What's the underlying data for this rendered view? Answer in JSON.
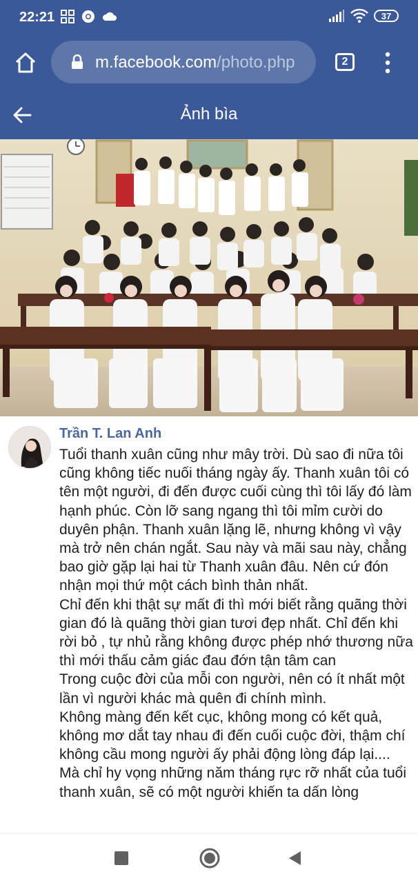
{
  "status_bar": {
    "time": "22:21",
    "battery": "37",
    "icons": [
      "grid-app-icon",
      "chrome-icon",
      "cloud-icon",
      "signal-icon",
      "wifi-icon",
      "battery-icon"
    ]
  },
  "browser": {
    "url_domain": "m.facebook.com",
    "url_path": "/photo.php",
    "tab_count": "2"
  },
  "header": {
    "title": "Ảnh bìa"
  },
  "photo": {
    "description_icons": [
      "wall-clock",
      "notice-board",
      "banner"
    ]
  },
  "post": {
    "author": "Trần T. Lan Anh",
    "paragraphs": [
      "Tuổi thanh xuân cũng như mây trời. Dù sao đi nữa tôi cũng không tiếc nuối tháng ngày ấy. Thanh xuân tôi có tên một người, đi đến được cuối cùng thì tôi lấy đó làm hạnh phúc. Còn lỡ sang ngang thì tôi mỉm cười do duyên phận. Thanh xuân lặng lẽ, nhưng không vì vậy mà trở nên chán ngắt. Sau này và mãi sau này, chẳng bao giờ gặp lại hai từ Thanh xuân đâu. Nên cứ đón nhận mọi thứ một cách bình thản nhất.",
      "Chỉ đến khi thật sự mất đi thì mới biết rằng quãng thời gian đó là quãng thời gian tươi đẹp nhất. Chỉ đến khi rời bỏ , tự nhủ rằng không được phép nhớ thương nữa thì mới thấu cảm giác đau đớn tận tâm can",
      "Trong cuộc đời của mỗi con người, nên có ít nhất một lần vì người khác mà quên đi chính mình.",
      "Không màng đến kết cục, không mong có kết quả, không mơ dắt tay nhau đi đến cuối cuộc đời, thậm chí không cầu mong người ấy phải động lòng đáp lại....",
      "Mà chỉ hy vọng những năm tháng rực rỡ nhất của tuổi thanh xuân, sẽ có một người khiến ta dấn lòng"
    ]
  },
  "colors": {
    "facebook_blue": "#3b5998",
    "author_blue": "#4b67a1",
    "text": "#1c1e21"
  }
}
